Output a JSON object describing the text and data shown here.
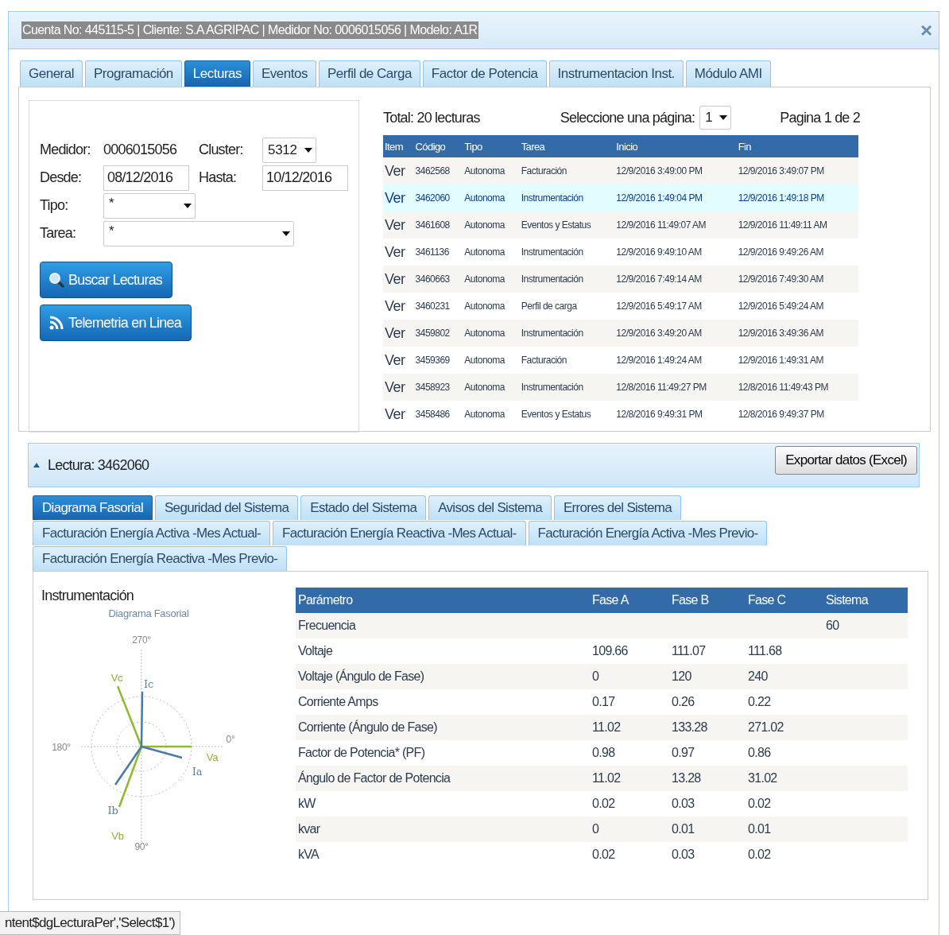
{
  "window": {
    "title": "Cuenta No: 445115-5 | Cliente: S.A AGRIPAC | Medidor No: 0006015056 | Modelo: A1R",
    "close": "×"
  },
  "tabs": [
    {
      "label": "General",
      "selected": false
    },
    {
      "label": "Programación",
      "selected": false
    },
    {
      "label": "Lecturas",
      "selected": true
    },
    {
      "label": "Eventos",
      "selected": false
    },
    {
      "label": "Perfil de Carga",
      "selected": false
    },
    {
      "label": "Factor de Potencia",
      "selected": false
    },
    {
      "label": "Instrumentacion Inst.",
      "selected": false
    },
    {
      "label": "Módulo AMI",
      "selected": false
    }
  ],
  "filters": {
    "medidor_label": "Medidor:",
    "medidor": "0006015056",
    "cluster_label": "Cluster:",
    "cluster": "5312",
    "desde_label": "Desde:",
    "desde": "08/12/2016",
    "hasta_label": "Hasta:",
    "hasta": "10/12/2016",
    "tipo_label": "Tipo:",
    "tipo": "*",
    "tarea_label": "Tarea:",
    "tarea": "*",
    "buttons": [
      {
        "label": "Buscar Lecturas",
        "kind": "search"
      },
      {
        "label": "Telemetria en Linea",
        "kind": "feed"
      }
    ]
  },
  "readings": {
    "total": "Total: 20 lecturas",
    "page_label": "Seleccione una página:",
    "page": "1",
    "page_info": "Pagina 1 de 2",
    "columns": [
      "Item",
      "Código",
      "Tipo",
      "Tarea",
      "Inicio",
      "Fin"
    ],
    "rows": [
      {
        "item": "Ver",
        "code": "3462568",
        "type": "Autonoma",
        "task": "Facturación",
        "start": "12/9/2016 3:49:00 PM",
        "end": "12/9/2016 3:49:07 PM",
        "selected": false
      },
      {
        "item": "Ver",
        "code": "3462060",
        "type": "Autonoma",
        "task": "Instrumentación",
        "start": "12/9/2016 1:49:04 PM",
        "end": "12/9/2016 1:49:18 PM",
        "selected": true
      },
      {
        "item": "Ver",
        "code": "3461608",
        "type": "Autonoma",
        "task": "Eventos y Estatus",
        "start": "12/9/2016 11:49:07 AM",
        "end": "12/9/2016 11:49:11 AM",
        "selected": false
      },
      {
        "item": "Ver",
        "code": "3461136",
        "type": "Autonoma",
        "task": "Instrumentación",
        "start": "12/9/2016 9:49:10 AM",
        "end": "12/9/2016 9:49:26 AM",
        "selected": false
      },
      {
        "item": "Ver",
        "code": "3460663",
        "type": "Autonoma",
        "task": "Instrumentación",
        "start": "12/9/2016 7:49:14 AM",
        "end": "12/9/2016 7:49:30 AM",
        "selected": false
      },
      {
        "item": "Ver",
        "code": "3460231",
        "type": "Autonoma",
        "task": "Perfil de carga",
        "start": "12/9/2016 5:49:17 AM",
        "end": "12/9/2016 5:49:24 AM",
        "selected": false
      },
      {
        "item": "Ver",
        "code": "3459802",
        "type": "Autonoma",
        "task": "Instrumentación",
        "start": "12/9/2016 3:49:20 AM",
        "end": "12/9/2016 3:49:36 AM",
        "selected": false
      },
      {
        "item": "Ver",
        "code": "3459369",
        "type": "Autonoma",
        "task": "Facturación",
        "start": "12/9/2016 1:49:24 AM",
        "end": "12/9/2016 1:49:31 AM",
        "selected": false
      },
      {
        "item": "Ver",
        "code": "3458923",
        "type": "Autonoma",
        "task": "Instrumentación",
        "start": "12/8/2016 11:49:27 PM",
        "end": "12/8/2016 11:49:43 PM",
        "selected": false
      },
      {
        "item": "Ver",
        "code": "3458486",
        "type": "Autonoma",
        "task": "Eventos y Estatus",
        "start": "12/8/2016 9:49:31 PM",
        "end": "12/8/2016 9:49:37 PM",
        "selected": false
      }
    ]
  },
  "reading_panel": {
    "title": "Lectura: 3462060",
    "expanded": true,
    "export_button": "Exportar datos (Excel)",
    "tab_rows": [
      [
        {
          "label": "Diagrama Fasorial",
          "selected": true
        },
        {
          "label": "Seguridad del Sistema",
          "selected": false
        },
        {
          "label": "Estado del Sistema",
          "selected": false
        },
        {
          "label": "Avisos del Sistema",
          "selected": false
        },
        {
          "label": "Errores del Sistema",
          "selected": false
        }
      ],
      [
        {
          "label": "Facturación Energía Activa -Mes Actual-",
          "selected": false
        },
        {
          "label": "Facturación Energía Reactiva -Mes Actual-",
          "selected": false
        },
        {
          "label": "Facturación Energía Activa -Mes Previo-",
          "selected": false
        }
      ],
      [
        {
          "label": "Facturación Energía Reactiva -Mes Previo-",
          "selected": false
        }
      ]
    ],
    "section_title": "Instrumentación",
    "phasor_diagram": {
      "title": "Diagrama Fasorial",
      "axis_labels": [
        "0°",
        "90°",
        "180°",
        "270°"
      ],
      "voltage_labels": [
        "Va",
        "Vb",
        "Vc"
      ],
      "current_labels": [
        "Ia",
        "Ib",
        "Ic"
      ]
    },
    "table": {
      "columns": [
        "Parámetro",
        "Fase A",
        "Fase B",
        "Fase C",
        "Sistema"
      ],
      "rows": [
        [
          "Frecuencia",
          "",
          "",
          "",
          "60"
        ],
        [
          "Voltaje",
          "109.66",
          "111.07",
          "111.68",
          ""
        ],
        [
          "Voltaje (Ángulo de Fase)",
          "0",
          "120",
          "240",
          ""
        ],
        [
          "Corriente Amps",
          "0.17",
          "0.26",
          "0.22",
          ""
        ],
        [
          "Corriente (Ángulo de Fase)",
          "11.02",
          "133.28",
          "271.02",
          ""
        ],
        [
          "Factor de Potencia* (PF)",
          "0.98",
          "0.97",
          "0.86",
          ""
        ],
        [
          "Ángulo de Factor de Potencia",
          "11.02",
          "13.28",
          "31.02",
          ""
        ],
        [
          "kW",
          "0.02",
          "0.03",
          "0.02",
          ""
        ],
        [
          "kvar",
          "0",
          "0.01",
          "0.01",
          ""
        ],
        [
          "kVA",
          "0.02",
          "0.03",
          "0.02",
          ""
        ]
      ]
    }
  },
  "status_bar": {
    "text": "ntent$dgLecturaPer','Select$1')"
  }
}
